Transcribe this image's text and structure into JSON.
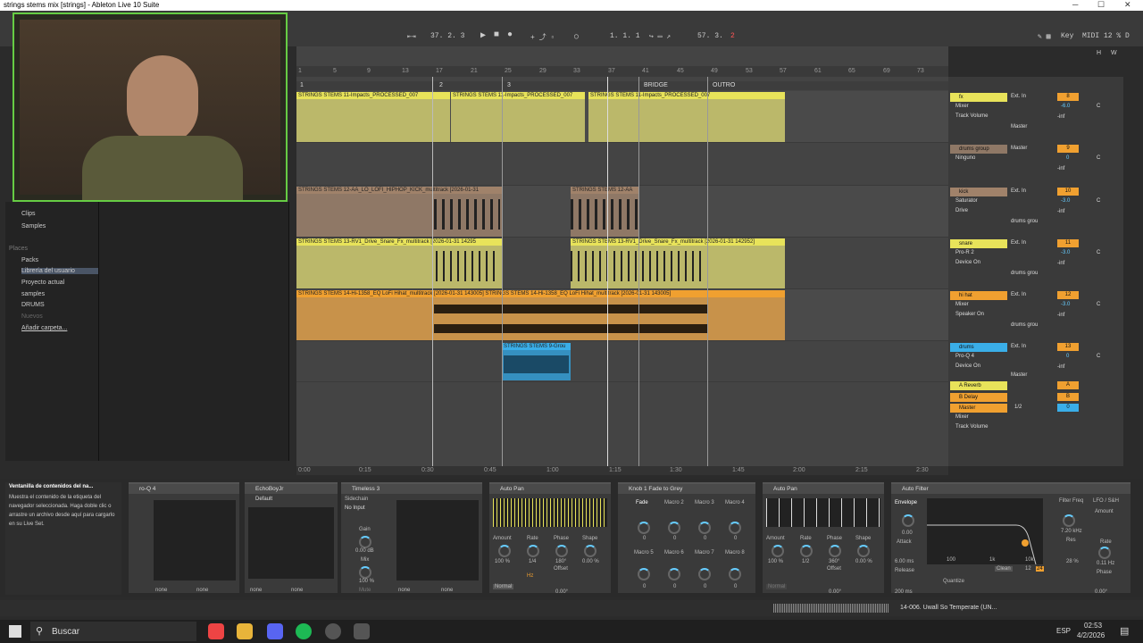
{
  "window": {
    "title": "strings stems mix  [strings] - Ableton Live 10 Suite",
    "min": "─",
    "max": "☐",
    "close": "✕"
  },
  "transport": {
    "loop_start": "37.  2.  3",
    "position": "1.  1.  1",
    "end": "57.  3.",
    "loop_len": "2",
    "key": "Key",
    "midi": "MIDI",
    "cpu": "12 %",
    "d_label": "D",
    "h_label": "H",
    "w_label": "W"
  },
  "ruler": [
    "1",
    "5",
    "9",
    "13",
    "17",
    "21",
    "25",
    "29",
    "33",
    "37",
    "41",
    "45",
    "49",
    "53",
    "57",
    "61",
    "65",
    "69",
    "73"
  ],
  "locators": [
    "1",
    "2",
    "3",
    "BRIDGE",
    "OUTRO"
  ],
  "timebar": [
    "0:00",
    "0:15",
    "0:30",
    "0:45",
    "1:00",
    "1:15",
    "1:30",
    "1:45",
    "2:00",
    "2:15",
    "2:30"
  ],
  "browser": {
    "items": [
      "Clips",
      "Samples"
    ],
    "places_header": "Places",
    "places": [
      "Packs",
      "Librería del usuario",
      "Proyecto actual",
      "samples",
      "DRUMS",
      "Nuevos",
      "Añadir carpeta..."
    ]
  },
  "clips": [
    {
      "name": "STRINGS STEMS 11-Impacts_PROCESSED_007",
      "color": "#e8e35a"
    },
    {
      "name": "STRINGS STEMS 11-Impacts_PROCESSED_007",
      "color": "#e8e35a"
    },
    {
      "name": "STRINGS STEMS 11-Impacts_PROCESSED_007",
      "color": "#e8e35a"
    },
    {
      "name": "STRINGS STEMS 12-AA_LO_LOFI_HIPHOP_KICK_multitrack [2026-01-31",
      "color": "#b89070"
    },
    {
      "name": "STRINGS STEMS 12-AA",
      "color": "#b89070"
    },
    {
      "name": "STRINGS STEMS 13-RV1_Drive_Snare_Fx_multitrack [2026-01-31 14295",
      "color": "#e8e35a"
    },
    {
      "name": "STRINGS STEMS 13-RV1_Drive_Snare_Fx_multitrack [2026-01-31 142952]",
      "color": "#e8e35a"
    },
    {
      "name": "STRINGS STEMS 14-Hi-1358_EQ LoFi Hihat_multitrack [2026-01-31 143005] STRINGS STEMS 14-Hi-1358_EQ LoFi Hihat_multitrack [2026-01-31 143005]",
      "color": "#f0a030"
    },
    {
      "name": "STRINGS STEMS 9-Grou",
      "color": "#3aaee8"
    }
  ],
  "mixer": [
    {
      "name": "fx",
      "color": "#e8e35a",
      "in": "Ext. In",
      "dev1": "Mixer",
      "dev2": "Track Volume",
      "out": "Master",
      "num": "8",
      "vol": "-6.0",
      "pan": "C",
      "inf": "-inf"
    },
    {
      "name": "drums group",
      "color": "#b89070",
      "in": "Master",
      "dev1": "Ninguno",
      "dev2": "",
      "out": "",
      "num": "9",
      "vol": "0",
      "pan": "C",
      "inf": "-inf"
    },
    {
      "name": "kick",
      "color": "#b89070",
      "in": "Ext. In",
      "dev1": "Saturator",
      "dev2": "Drive",
      "out": "drums grou",
      "num": "10",
      "vol": "-3.0",
      "pan": "C",
      "inf": "-inf"
    },
    {
      "name": "snare",
      "color": "#e8e35a",
      "in": "Ext. In",
      "dev1": "Pro-R 2",
      "dev2": "Device On",
      "out": "drums grou",
      "num": "11",
      "vol": "-3.0",
      "pan": "C",
      "inf": "-inf"
    },
    {
      "name": "hi hat",
      "color": "#f0a030",
      "in": "Ext. In",
      "dev1": "Mixer",
      "dev2": "Speaker On",
      "out": "drums grou",
      "num": "12",
      "vol": "-3.0",
      "pan": "C",
      "inf": "-inf"
    },
    {
      "name": "drums",
      "color": "#3aaee8",
      "in": "Ext. In",
      "dev1": "Pro-Q 4",
      "dev2": "Device On",
      "out": "Master",
      "num": "13",
      "vol": "0",
      "pan": "C",
      "inf": "-inf"
    }
  ],
  "returns": [
    {
      "name": "A Reverb",
      "num": "A"
    },
    {
      "name": "B Delay",
      "num": "B"
    },
    {
      "name": "Master",
      "num": "0"
    }
  ],
  "master": {
    "dev1": "Mixer",
    "dev2": "Track Volume",
    "cue": "1/2"
  },
  "info": {
    "title": "Ventanilla de contenidos del na...",
    "body": "Muestra el contenido de la etiqueta del navegador seleccionada. Haga doble clic o arrastre un archivo desde aquí para cargarlo en su Live Set."
  },
  "devices": [
    {
      "title": "ro-Q 4",
      "sub": "",
      "a": "none",
      "b": "none"
    },
    {
      "title": "EchoBoyJr",
      "sub": "Default",
      "a": "none",
      "b": "none"
    },
    {
      "title": "Timeless 3",
      "sub": "",
      "a": "none",
      "b": "none"
    },
    {
      "title": "Auto Pan",
      "sub": "",
      "a": "",
      "b": ""
    },
    {
      "title": "Knob 1 Fade to Grey",
      "sub": "Fade",
      "a": "",
      "b": ""
    },
    {
      "title": "Auto Pan",
      "sub": "",
      "a": "",
      "b": ""
    },
    {
      "title": "Auto Filter",
      "sub": "Envelope",
      "a": "",
      "b": ""
    }
  ],
  "sidechain": {
    "label": "Sidechain",
    "input": "No Input",
    "gain": "Gain",
    "gain_val": "0.00 dB",
    "mix": "Mix",
    "mix_val": "100 %",
    "mute": "Mute"
  },
  "autopan": {
    "amount": "Amount",
    "rate": "Rate",
    "phase": "Phase",
    "shape": "Shape",
    "amount_val": "100 %",
    "rate_val": "1/4",
    "phase_val": "180°",
    "shape_val": "0.00 %",
    "offset": "Offset",
    "offset_val": "0.00°",
    "mode": "Normal",
    "hz": "Hz"
  },
  "autopan2": {
    "rate_val": "1/2",
    "phase_val": "360°",
    "offset_val": "0.00°"
  },
  "macros": [
    "Macro 2",
    "Macro 3",
    "Macro 4",
    "Macro 5",
    "Macro 6",
    "Macro 7",
    "Macro 8"
  ],
  "macro_vals": [
    "0",
    "0",
    "0",
    "0",
    "0",
    "0",
    "0",
    "0"
  ],
  "autofilter": {
    "env_val": "0.00",
    "attack": "Attack",
    "attack_val": "6.00 ms",
    "release": "Release",
    "release_val": "200 ms",
    "freq": "Filter Freq",
    "freq_val": "7.20 kHz",
    "res": "Res",
    "res_val": "28 %",
    "lfo": "LFO / S&H",
    "lfo_amount": "Amount",
    "lfo_rate": "Rate",
    "lfo_rate_val": "0.11 Hz",
    "lfo_phase": "Phase",
    "lfo_phase_val": "0.00°",
    "clean": "Clean",
    "quantize": "Quantize",
    "f100": "100",
    "f1k": "1k",
    "f10k": "10k",
    "b12": "12",
    "b24": "24"
  },
  "status": {
    "track": "14-006. Uwall So Temperate (UN..."
  },
  "taskbar": {
    "search": "Buscar",
    "lang": "ESP",
    "time": "02:53",
    "date": "4/2/2026"
  }
}
